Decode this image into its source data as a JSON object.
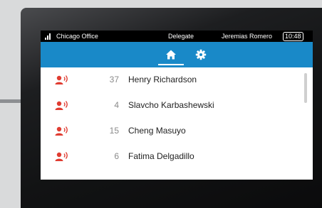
{
  "status_bar": {
    "location": "Chicago Office",
    "mode": "Delegate",
    "user": "Jeremias Romero",
    "time": "10:48"
  },
  "nav": {
    "tabs": [
      {
        "name": "home",
        "icon": "home-icon",
        "selected": true
      },
      {
        "name": "settings",
        "icon": "gear-icon",
        "selected": false
      }
    ]
  },
  "calls": [
    {
      "count": "37",
      "name": "Henry Richardson"
    },
    {
      "count": "4",
      "name": "Slavcho Karbashewski"
    },
    {
      "count": "15",
      "name": "Cheng Masuyo"
    },
    {
      "count": "6",
      "name": "Fatima Delgadillo"
    }
  ],
  "colors": {
    "accent": "#1989c8",
    "call_icon": "#e03c31",
    "status_bar_bg": "#000000"
  }
}
